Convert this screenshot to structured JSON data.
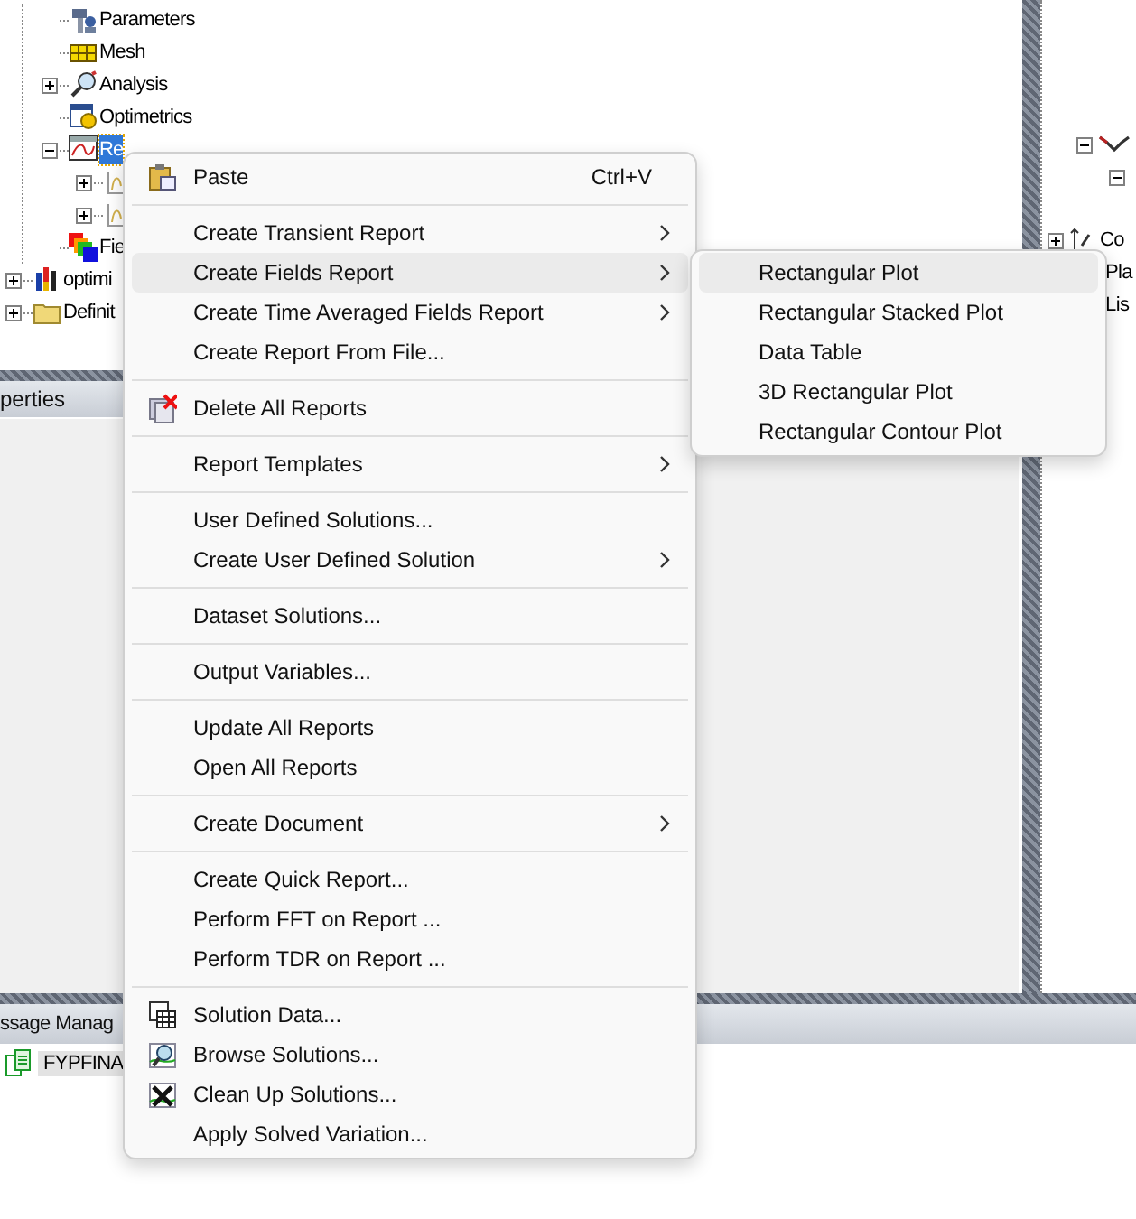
{
  "tree": {
    "nested_items": [
      {
        "label": "Parameters",
        "selected": false
      },
      {
        "label": "Mesh",
        "selected": false
      },
      {
        "label": "Analysis",
        "expanded": false,
        "selected": false
      },
      {
        "label": "Optimetrics",
        "selected": false
      },
      {
        "label": "Re",
        "expanded": true,
        "selected": true,
        "children": [
          {
            "expanded": false
          },
          {
            "expanded": false
          }
        ]
      },
      {
        "label": "Fie",
        "selected": false
      }
    ],
    "items": [
      {
        "label": "optimi",
        "expanded": false,
        "selected": false
      },
      {
        "label": "Definit",
        "expanded": false,
        "selected": false
      }
    ]
  },
  "right_tree": {
    "items": [
      {
        "expanded": true
      },
      {
        "expanded": true
      },
      {
        "label": "Co",
        "expanded": false
      },
      {
        "label": "Pla"
      },
      {
        "label": "Lis"
      }
    ]
  },
  "properties_panel": {
    "title": "perties"
  },
  "message_manager": {
    "title": "ssage Manag",
    "items": [
      {
        "label": "FYPFINA",
        "selected": true
      }
    ]
  },
  "context_menu": {
    "items": [
      {
        "kind": "item",
        "label": "Paste",
        "shortcut": "Ctrl+V",
        "submenu": false,
        "selected": false
      },
      {
        "kind": "separator"
      },
      {
        "kind": "item",
        "label": "Create Transient Report",
        "submenu": true,
        "selected": false
      },
      {
        "kind": "item",
        "label": "Create Fields Report",
        "submenu": true,
        "selected": true
      },
      {
        "kind": "item",
        "label": "Create Time Averaged Fields Report",
        "submenu": true,
        "selected": false
      },
      {
        "kind": "item",
        "label": "Create Report From File...",
        "submenu": false,
        "selected": false
      },
      {
        "kind": "separator"
      },
      {
        "kind": "item",
        "label": "Delete All Reports",
        "submenu": false,
        "selected": false
      },
      {
        "kind": "separator"
      },
      {
        "kind": "item",
        "label": "Report Templates",
        "submenu": true,
        "selected": false
      },
      {
        "kind": "separator"
      },
      {
        "kind": "item",
        "label": "User Defined Solutions...",
        "submenu": false,
        "selected": false
      },
      {
        "kind": "item",
        "label": "Create User Defined Solution",
        "submenu": true,
        "selected": false
      },
      {
        "kind": "separator"
      },
      {
        "kind": "item",
        "label": "Dataset Solutions...",
        "submenu": false,
        "selected": false
      },
      {
        "kind": "separator"
      },
      {
        "kind": "item",
        "label": "Output Variables...",
        "submenu": false,
        "selected": false
      },
      {
        "kind": "separator"
      },
      {
        "kind": "item",
        "label": "Update All Reports",
        "submenu": false,
        "selected": false
      },
      {
        "kind": "item",
        "label": "Open All Reports",
        "submenu": false,
        "selected": false
      },
      {
        "kind": "separator"
      },
      {
        "kind": "item",
        "label": "Create Document",
        "submenu": true,
        "selected": false
      },
      {
        "kind": "separator"
      },
      {
        "kind": "item",
        "label": "Create Quick Report...",
        "submenu": false,
        "selected": false
      },
      {
        "kind": "item",
        "label": "Perform FFT on Report ...",
        "submenu": false,
        "selected": false
      },
      {
        "kind": "item",
        "label": "Perform TDR on Report ...",
        "submenu": false,
        "selected": false
      },
      {
        "kind": "separator"
      },
      {
        "kind": "item",
        "label": "Solution Data...",
        "submenu": false,
        "selected": false
      },
      {
        "kind": "item",
        "label": "Browse Solutions...",
        "submenu": false,
        "selected": false
      },
      {
        "kind": "item",
        "label": "Clean Up Solutions...",
        "submenu": false,
        "selected": false
      },
      {
        "kind": "item",
        "label": "Apply Solved Variation...",
        "submenu": false,
        "selected": false
      }
    ]
  },
  "submenu": {
    "items": [
      {
        "label": "Rectangular Plot",
        "selected": true
      },
      {
        "label": "Rectangular Stacked Plot",
        "selected": false
      },
      {
        "label": "Data Table",
        "selected": false
      },
      {
        "label": "3D Rectangular Plot",
        "selected": false
      },
      {
        "label": "Rectangular Contour Plot",
        "selected": false
      }
    ]
  }
}
